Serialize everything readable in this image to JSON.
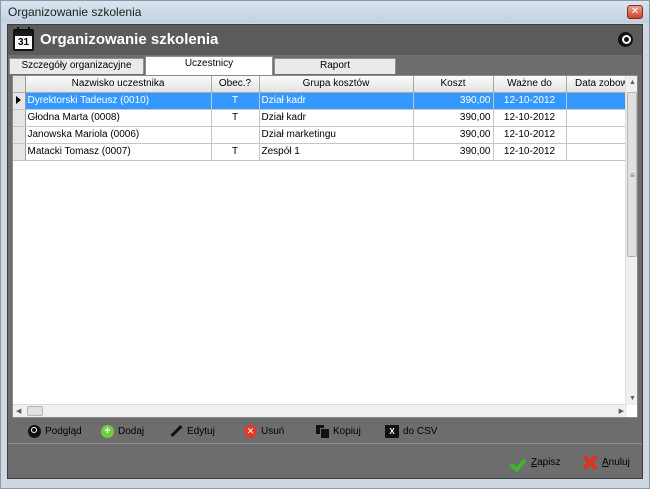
{
  "window": {
    "title": "Organizowanie szkolenia"
  },
  "header": {
    "title": "Organizowanie szkolenia",
    "calendar_day": "31"
  },
  "tabs": [
    {
      "label": "Szczegóły organizacyjne",
      "active": false
    },
    {
      "label": "Uczestnicy",
      "active": true
    },
    {
      "label": "Raport",
      "active": false
    }
  ],
  "grid": {
    "columns": [
      "Nazwisko uczestnika",
      "Obec.?",
      "Grupa kosztów",
      "Koszt",
      "Ważne do",
      "Data zobow."
    ],
    "rows": [
      {
        "name": "Dyrektorski Tadeusz (0010)",
        "present": "T",
        "group": "Dział kadr",
        "cost": "390,00",
        "valid": "12-10-2012",
        "date": "",
        "selected": true
      },
      {
        "name": "Głodna Marta (0008)",
        "present": "T",
        "group": "Dział kadr",
        "cost": "390,00",
        "valid": "12-10-2012",
        "date": "",
        "selected": false
      },
      {
        "name": "Janowska Mariola (0006)",
        "present": "",
        "group": "Dział marketingu",
        "cost": "390,00",
        "valid": "12-10-2012",
        "date": "",
        "selected": false
      },
      {
        "name": "Matacki Tomasz (0007)",
        "present": "T",
        "group": "Zespół 1",
        "cost": "390,00",
        "valid": "12-10-2012",
        "date": "",
        "selected": false
      }
    ]
  },
  "toolbar": {
    "preview": "Podgląd",
    "add": "Dodaj",
    "edit": "Edytuj",
    "delete": "Usuń",
    "copy": "Kopiuj",
    "csv": "do CSV"
  },
  "footer": {
    "save_prefix": "Z",
    "save_rest": "apisz",
    "cancel_prefix": "A",
    "cancel_rest": "nuluj"
  },
  "colors": {
    "selection": "#3399ff",
    "panel": "#6d6d6d",
    "header": "#5b5b5b"
  }
}
